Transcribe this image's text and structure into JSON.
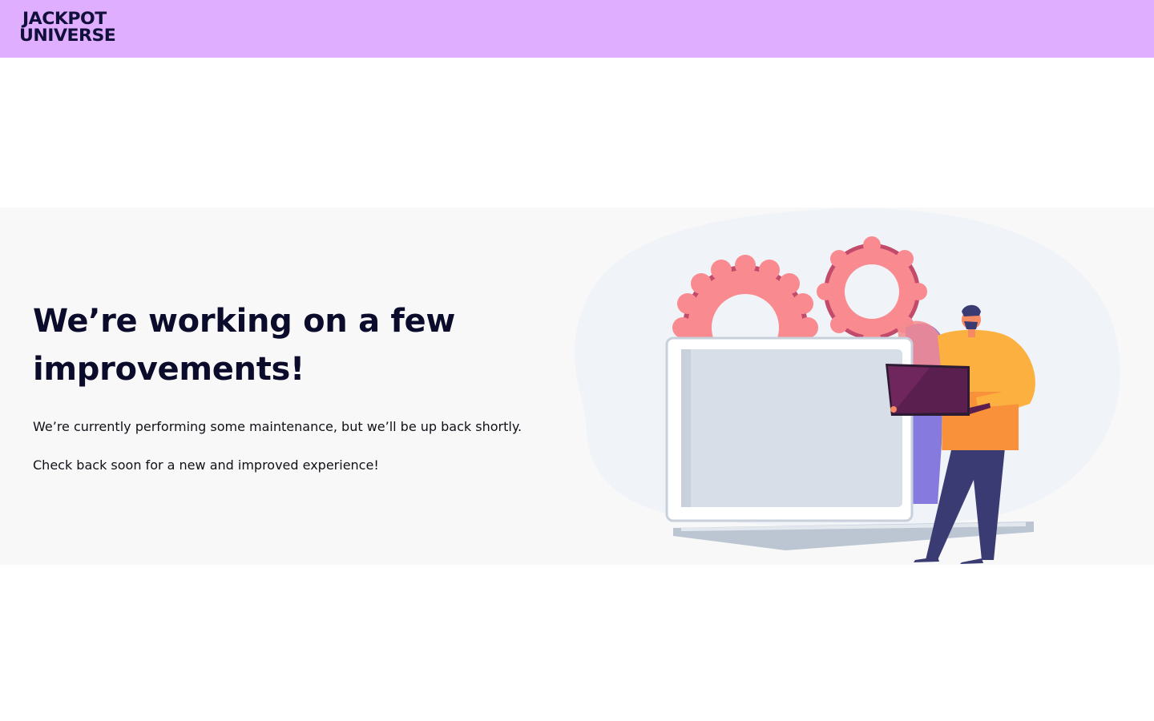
{
  "brand": {
    "logo_line1": "JACKPOT",
    "logo_line2": "UNIVERSE",
    "header_bg": "#e0aeff",
    "logo_color": "#10103a"
  },
  "maintenance": {
    "title": "We’re working on a few improvements!",
    "message1": "We’re currently performing some maintenance, but we’ll be up back shortly.",
    "message2": "Check back soon for a new and improved experience!"
  },
  "illustration": {
    "icon": "maintenance-illustration",
    "colors": {
      "blob": "#f0f3f7",
      "gear": "#f98a8f",
      "laptop_screen": "#d7dee7",
      "laptop_body": "#bcc6d3",
      "shirt": "#fbb040",
      "pants": "#3b3b74",
      "device": "#5a1f4f"
    }
  }
}
